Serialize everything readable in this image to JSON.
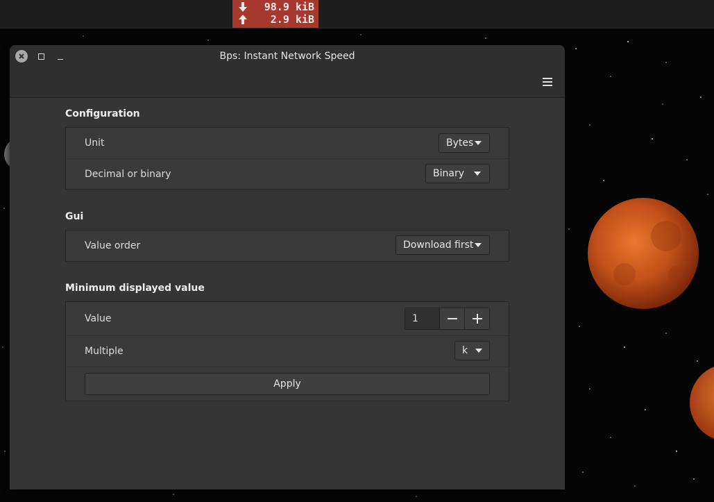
{
  "panel": {
    "download_value": "98.9 kiB",
    "upload_value": "2.9 kiB",
    "download_icon": "arrow-down-icon",
    "upload_icon": "arrow-up-icon",
    "indicator_color": "#a6382e"
  },
  "window": {
    "title": "Bps: Instant Network Speed",
    "close_icon": "close-icon",
    "maximize_icon": "maximize-icon",
    "minimize_icon": "minimize-icon",
    "menu_icon": "hamburger-menu-icon"
  },
  "configuration": {
    "title": "Configuration",
    "unit_label": "Unit",
    "unit_value": "Bytes",
    "decimal_label": "Decimal or binary",
    "decimal_value": "Binary"
  },
  "gui": {
    "title": "Gui",
    "order_label": "Value order",
    "order_value": "Download first"
  },
  "minimum": {
    "title": "Minimum displayed value",
    "value_label": "Value",
    "value": "1",
    "multiple_label": "Multiple",
    "multiple_value": "k",
    "apply_label": "Apply"
  }
}
